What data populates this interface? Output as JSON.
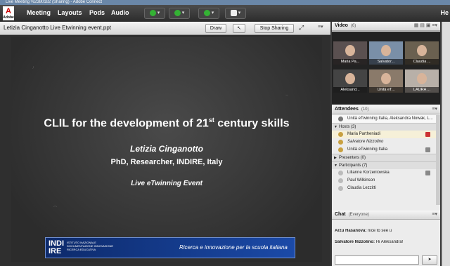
{
  "window": {
    "title": "Live Meeting %2380182 (Sharing) - Adobe Connect"
  },
  "logo": {
    "letter": "A",
    "text": "Adobe"
  },
  "menu": {
    "items": [
      "Meeting",
      "Layouts",
      "Pods",
      "Audio"
    ],
    "help": "He"
  },
  "share_pod": {
    "title": "Letizia Cinganotto Live Etwinning event.ppt",
    "draw_label": "Draw",
    "stop_label": "Stop Sharing"
  },
  "slide": {
    "title_main": "CLIL for the development of 21",
    "title_sup": "st",
    "title_end": " century skills",
    "author": "Letizia Cinganotto",
    "role": "PhD, Researcher, INDIRE, Italy",
    "event": "Live eTwinning Event",
    "banner_logo_line1": "INDI",
    "banner_logo_line2": "IRE",
    "banner_small": "ISTITUTO NAZIONALE DOCUMENTAZIONE INNOVAZIONE RICERCA EDUCATIVA",
    "banner_tagline": "Ricerca e innovazione per la scuola italiana"
  },
  "video": {
    "title": "Video",
    "count": "(6)",
    "tiles": [
      "Maria Pa...",
      "Salvator...",
      "Claudia ...",
      "Aleksand...",
      "Unità eT...",
      "LAURA ..."
    ]
  },
  "attendees": {
    "title": "Attendees",
    "count": "(10)",
    "active_speakers": "Unità eTwinning Italia, Aleksandra Nowak, L...",
    "hosts_label": "Hosts (3)",
    "hosts": [
      "Maria Partheniadi",
      "Salvatore Nizzolino",
      "Unità eTwinning Italia"
    ],
    "presenters_label": "Presenters (0)",
    "participants_label": "Participants (7)",
    "participants": [
      "Lilianne Korzeniowska",
      "Paul Wilkinson",
      "Claudia Lezzitti"
    ]
  },
  "chat": {
    "title": "Chat",
    "scope": "(Everyone)",
    "messages": [
      {
        "sender": "Arzu Hasanova:",
        "text": "nice to see u"
      },
      {
        "sender": "Salvatore Nizzolino:",
        "text": "Hi Aleksandra!"
      }
    ]
  },
  "colors": {
    "accent": "#1b4aa8",
    "mic_green": "#34b234"
  }
}
